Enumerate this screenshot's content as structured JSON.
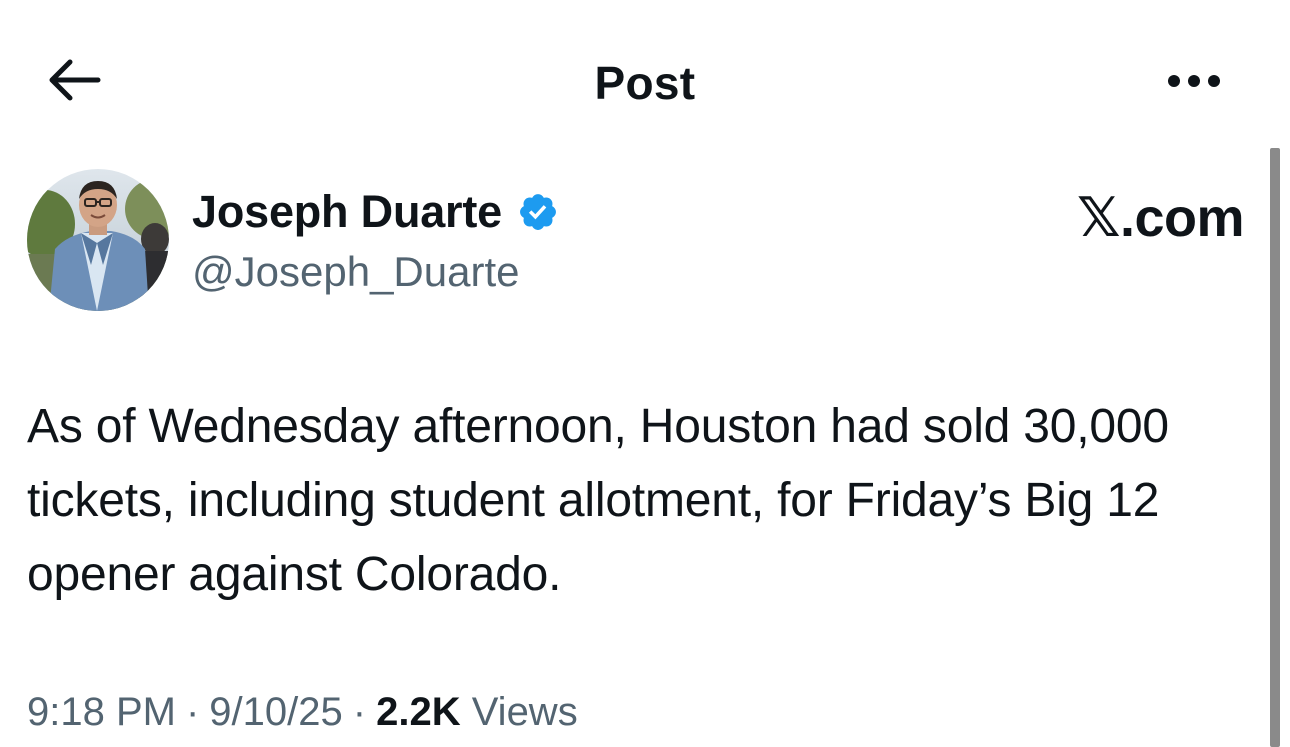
{
  "header": {
    "title": "Post",
    "back_icon": "arrow-left-icon",
    "more_icon": "more-horizontal-icon"
  },
  "author": {
    "display_name": "Joseph Duarte",
    "handle": "@Joseph_Duarte",
    "verified": true,
    "verified_color": "#1d9bf0"
  },
  "watermark": "𝕏.com",
  "post": {
    "text": "As of Wednesday afternoon, Houston had sold 30,000 tickets, including student allotment, for Friday’s Big 12 opener against Colorado."
  },
  "meta": {
    "time": "9:18 PM",
    "date": "9/10/25",
    "separator": "·",
    "views_count": "2.2K",
    "views_label": "Views"
  },
  "colors": {
    "text_primary": "#0f1419",
    "text_secondary": "#536471",
    "accent": "#1d9bf0"
  }
}
